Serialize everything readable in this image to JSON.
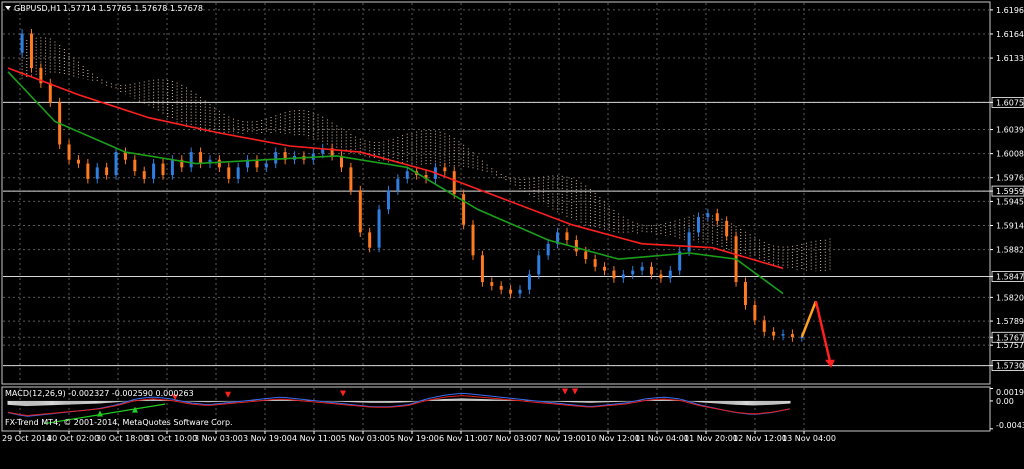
{
  "header": {
    "symbol": "GBPUSD,H1",
    "ohlc": "1.57714 1.57765 1.57678 1.57678"
  },
  "macd": {
    "label": "MACD(12,26,9) -0.002327 -0.002590 0.000263",
    "ticks": [
      "0.00192",
      "0.00",
      "-0.004317"
    ]
  },
  "copyright": "FX-Trend MT4, © 2001-2014, MetaQuotes Software Corp.",
  "chart_data": {
    "type": "line",
    "title": "GBPUSD,H1",
    "ylim": [
      1.5708,
      1.6205
    ],
    "y_ticks": [
      "1.61960",
      "1.61645",
      "1.61330",
      "1.60750",
      "1.60395",
      "1.60080",
      "1.59765",
      "1.59590",
      "1.59455",
      "1.59140",
      "1.58825",
      "1.58473",
      "1.58200",
      "1.57890",
      "1.57678",
      "1.57575",
      "1.57308"
    ],
    "x_ticks": [
      "29 Oct 2014",
      "30 Oct 02:00",
      "30 Oct 18:00",
      "31 Oct 10:00",
      "3 Nov 03:00",
      "3 Nov 19:00",
      "4 Nov 11:00",
      "5 Nov 03:00",
      "5 Nov 19:00",
      "6 Nov 11:00",
      "7 Nov 03:00",
      "7 Nov 19:00",
      "10 Nov 12:00",
      "11 Nov 04:00",
      "11 Nov 20:00",
      "12 Nov 12:00",
      "13 Nov 04:00"
    ],
    "horizontal_levels": [
      1.6075,
      1.5959,
      1.58473,
      1.57308
    ],
    "highlighted_price": 1.57678,
    "price_path": [
      [
        0,
        1.614
      ],
      [
        6,
        1.6165
      ],
      [
        10,
        1.612
      ],
      [
        14,
        1.61
      ],
      [
        18,
        1.6075
      ],
      [
        22,
        1.602
      ],
      [
        26,
        1.6
      ],
      [
        30,
        1.5995
      ],
      [
        34,
        1.5975
      ],
      [
        38,
        1.599
      ],
      [
        42,
        1.598
      ],
      [
        46,
        1.601
      ],
      [
        50,
        1.6
      ],
      [
        54,
        1.5985
      ],
      [
        58,
        1.5975
      ],
      [
        62,
        1.5995
      ],
      [
        66,
        1.598
      ],
      [
        70,
        1.6
      ],
      [
        74,
        1.599
      ],
      [
        78,
        1.601
      ],
      [
        82,
        1.5995
      ],
      [
        86,
        1.6
      ],
      [
        90,
        1.599
      ],
      [
        94,
        1.5975
      ],
      [
        98,
        1.599
      ],
      [
        102,
        1.6
      ],
      [
        106,
        1.599
      ],
      [
        110,
        1.5995
      ],
      [
        114,
        1.601
      ],
      [
        118,
        1.6
      ],
      [
        122,
        1.6005
      ],
      [
        126,
        1.6
      ],
      [
        130,
        1.6008
      ],
      [
        134,
        1.6015
      ],
      [
        138,
        1.6005
      ],
      [
        142,
        1.599
      ],
      [
        146,
        1.596
      ],
      [
        150,
        1.5905
      ],
      [
        154,
        1.5885
      ],
      [
        158,
        1.5935
      ],
      [
        162,
        1.596
      ],
      [
        166,
        1.5975
      ],
      [
        170,
        1.5985
      ],
      [
        174,
        1.598
      ],
      [
        178,
        1.5975
      ],
      [
        182,
        1.599
      ],
      [
        186,
        1.5985
      ],
      [
        190,
        1.5955
      ],
      [
        194,
        1.5915
      ],
      [
        198,
        1.5875
      ],
      [
        202,
        1.584
      ],
      [
        206,
        1.5835
      ],
      [
        210,
        1.583
      ],
      [
        214,
        1.5825
      ],
      [
        218,
        1.583
      ],
      [
        222,
        1.585
      ],
      [
        226,
        1.5875
      ],
      [
        230,
        1.589
      ],
      [
        234,
        1.5905
      ],
      [
        238,
        1.5895
      ],
      [
        242,
        1.588
      ],
      [
        246,
        1.587
      ],
      [
        250,
        1.586
      ],
      [
        254,
        1.5855
      ],
      [
        258,
        1.5845
      ],
      [
        262,
        1.585
      ],
      [
        266,
        1.5855
      ],
      [
        270,
        1.586
      ],
      [
        274,
        1.585
      ],
      [
        278,
        1.5845
      ],
      [
        282,
        1.5855
      ],
      [
        286,
        1.588
      ],
      [
        290,
        1.5905
      ],
      [
        294,
        1.5925
      ],
      [
        298,
        1.593
      ],
      [
        302,
        1.592
      ],
      [
        306,
        1.59
      ],
      [
        310,
        1.584
      ],
      [
        314,
        1.581
      ],
      [
        318,
        1.579
      ],
      [
        322,
        1.5775
      ],
      [
        326,
        1.577
      ],
      [
        330,
        1.5772
      ],
      [
        334,
        1.5768
      ],
      [
        338,
        1.5768
      ]
    ],
    "forecast_path": [
      [
        338,
        1.5768
      ],
      [
        344,
        1.5815
      ],
      [
        350,
        1.5728
      ]
    ],
    "series": [
      {
        "type": "ma",
        "values": [
          [
            0,
            1.612
          ],
          [
            30,
            1.6085
          ],
          [
            60,
            1.6055
          ],
          [
            90,
            1.6035
          ],
          [
            120,
            1.6018
          ],
          [
            150,
            1.601
          ],
          [
            180,
            1.5985
          ],
          [
            210,
            1.595
          ],
          [
            240,
            1.5915
          ],
          [
            270,
            1.589
          ],
          [
            300,
            1.5885
          ],
          [
            330,
            1.5858
          ]
        ]
      },
      {
        "type": "ma",
        "values": [
          [
            0,
            1.6115
          ],
          [
            20,
            1.605
          ],
          [
            50,
            1.601
          ],
          [
            80,
            1.5995
          ],
          [
            110,
            1.6
          ],
          [
            140,
            1.6005
          ],
          [
            170,
            1.599
          ],
          [
            200,
            1.5935
          ],
          [
            230,
            1.5895
          ],
          [
            260,
            1.587
          ],
          [
            290,
            1.5878
          ],
          [
            310,
            1.587
          ],
          [
            330,
            1.5825
          ]
        ]
      }
    ],
    "macd_hist": [
      -0.0006,
      -0.0008,
      -0.0007,
      -0.0006,
      -0.0005,
      -0.0004,
      -0.0002,
      0.0001,
      0.0002,
      0.0001,
      -0.0001,
      -0.0002,
      -0.0001,
      0.0,
      0.0001,
      0.0002,
      0.0001,
      0.0,
      -0.0001,
      -0.0002,
      -0.0003,
      -0.0003,
      -0.0002,
      0.0001,
      0.0003,
      0.0004,
      0.0003,
      0.0002,
      0.0001,
      0.0,
      -0.0001,
      -0.0002,
      -0.0003,
      -0.0002,
      -0.0001,
      0.0001,
      0.0002,
      0.0001,
      -0.0002,
      -0.0004,
      -0.0006,
      -0.0007,
      -0.0006,
      -0.0004
    ]
  }
}
